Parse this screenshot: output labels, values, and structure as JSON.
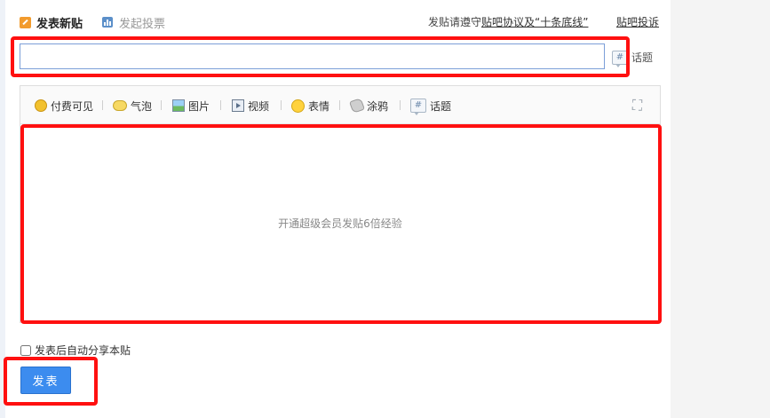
{
  "tabs": [
    {
      "label": "发表新贴",
      "icon": "pen-icon",
      "active": true
    },
    {
      "label": "发起投票",
      "icon": "bar-chart-icon",
      "active": false
    }
  ],
  "notice": {
    "prefix": "发贴请遵守",
    "link_agreement": "贴吧协议及“十条底线”",
    "complain": "贴吧投诉"
  },
  "title_input": {
    "value": "",
    "placeholder": ""
  },
  "topic_button": {
    "label": "话题",
    "icon": "hash-icon"
  },
  "toolbar": {
    "items": [
      {
        "label": "付费可见",
        "icon": "coin-icon"
      },
      {
        "label": "气泡",
        "icon": "bubble-icon"
      },
      {
        "label": "图片",
        "icon": "image-icon"
      },
      {
        "label": "视频",
        "icon": "video-icon"
      },
      {
        "label": "表情",
        "icon": "emoji-icon"
      },
      {
        "label": "涂鸦",
        "icon": "graffiti-icon"
      },
      {
        "label": "话题",
        "icon": "hash-icon"
      }
    ],
    "expand_icon": "expand-icon"
  },
  "editor": {
    "placeholder": "开通超级会员发贴6倍经验"
  },
  "share": {
    "label": "发表后自动分享本贴",
    "checked": false
  },
  "submit": {
    "label": "发表"
  },
  "colors": {
    "highlight": "#ff1010",
    "button": "#3c8cef",
    "input_border": "#7c9fd8",
    "tab_icon": "#f29b2d",
    "vote_icon": "#5b8fc9"
  }
}
